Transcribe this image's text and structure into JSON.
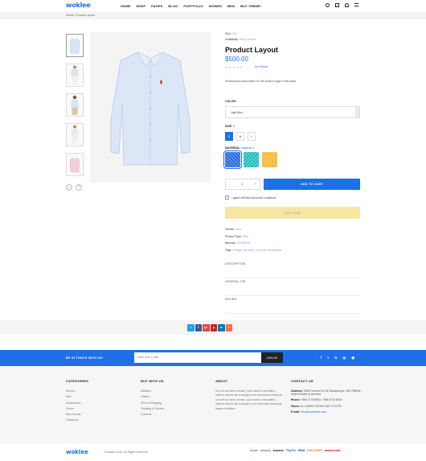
{
  "header": {
    "logo": "woklee",
    "nav": [
      "HOME",
      "SHOP",
      "PAGES",
      "BLOG",
      "PORTFOLIO",
      "WOMEN",
      "MEN",
      "BUY THEME!"
    ]
  },
  "breadcrumb": "Home  |  Product Layout",
  "product": {
    "sku_label": "SKU:",
    "sku_value": "020",
    "availability_label": "Availability:",
    "availability_value": "Many in stock",
    "title": "Product Layout",
    "price": "$500.00",
    "rating_stars": 0,
    "reviews_text": "No reviews",
    "description": "Small product description for the product page in this place",
    "color_label": "COLOR:",
    "color_value": "Light Blue",
    "size_label": "SIZE:",
    "size_selected": "S",
    "sizes": [
      "S",
      "M",
      "L"
    ],
    "material_label": "MATERIAL:",
    "material_selected": "Material 1",
    "quantity": "1",
    "quantity_minus": "-",
    "quantity_plus": "+",
    "add_to_cart": "ADD TO CART",
    "agree_text": "I agree with the terms and conditions",
    "buy_now": "BUY NOW",
    "vendor_label": "Vendor:",
    "vendor_value": "Vans",
    "type_label": "Product Type:",
    "type_value": "Shirt",
    "barcode_label": "Barcode:",
    "barcode_value": "123456789",
    "tags_label": "Tags:",
    "tags_value": "Vintage, Awesome, Summer, Beachwear",
    "tabs": [
      "DESCRIPTION",
      "GENERAL TAB",
      "REVIEW"
    ]
  },
  "share": {
    "buttons": [
      {
        "glyph": "t",
        "color": "#1da1f2"
      },
      {
        "glyph": "f",
        "color": "#3b5998"
      },
      {
        "glyph": "g+",
        "color": "#dd4b39"
      },
      {
        "glyph": "p",
        "color": "#cb2027"
      },
      {
        "glyph": "in",
        "color": "#0077b5"
      },
      {
        "glyph": "+",
        "color": "#f26c4f"
      }
    ]
  },
  "newsletter": {
    "title": "BE IN TOUCH WITH US:",
    "placeholder": "Enter your e-mail",
    "button": "JOIN US",
    "social": [
      "f",
      "t",
      "G",
      "◎",
      "◉"
    ]
  },
  "footer": {
    "categories": {
      "title": "CATEGORIES",
      "items": [
        "Women",
        "Men",
        "Accessories",
        "Shoes",
        "New Arrivals",
        "Clearence"
      ]
    },
    "buy": {
      "title": "BUY WITH US",
      "items": [
        "Affiliates",
        "Gallery",
        "Secure Shopping",
        "Shipping & Returns",
        "Contacts"
      ]
    },
    "about": {
      "title": "ABOUT",
      "text": "Ut enim ad minim veniam, quis nostrud exercitation ullamco laboris nisi ut aliquip ex ea commodo consequat. Ut enim ad minim veniam, quis nostrud exercitation ullamco laboris nisi ut aliquip ex ea commodo consequat tempor incididunt"
    },
    "contact": {
      "title": "CONTACT US",
      "address_label": "Address:",
      "address": "7805 Fremont Dr NE Albuquerque, NM 788006, United States of America",
      "phone_label": "Phone:",
      "phone": "+586 4778 8900, +586 4778 8900",
      "hours_label": "Hours:",
      "hours": "ALL WEEK FROM 9 AM TO 9 PM",
      "email_label": "E-mail:",
      "email": "info@mydomain.com"
    },
    "bottom_logo": "woklee",
    "copyright": "© Woklee 2018. All Rights Reserved",
    "payments": [
      {
        "name": "stripe",
        "color": "#6772e5"
      },
      {
        "name": "shopify",
        "color": "#5e8e3e"
      },
      {
        "name": "amazon",
        "color": "#222222"
      },
      {
        "name": "PayPal",
        "color": "#1e6fe8"
      },
      {
        "name": "VISA",
        "color": "#1a1f71"
      },
      {
        "name": "DISCOVER",
        "color": "#e67e22"
      },
      {
        "name": "mastercard",
        "color": "#eb001b"
      }
    ]
  }
}
